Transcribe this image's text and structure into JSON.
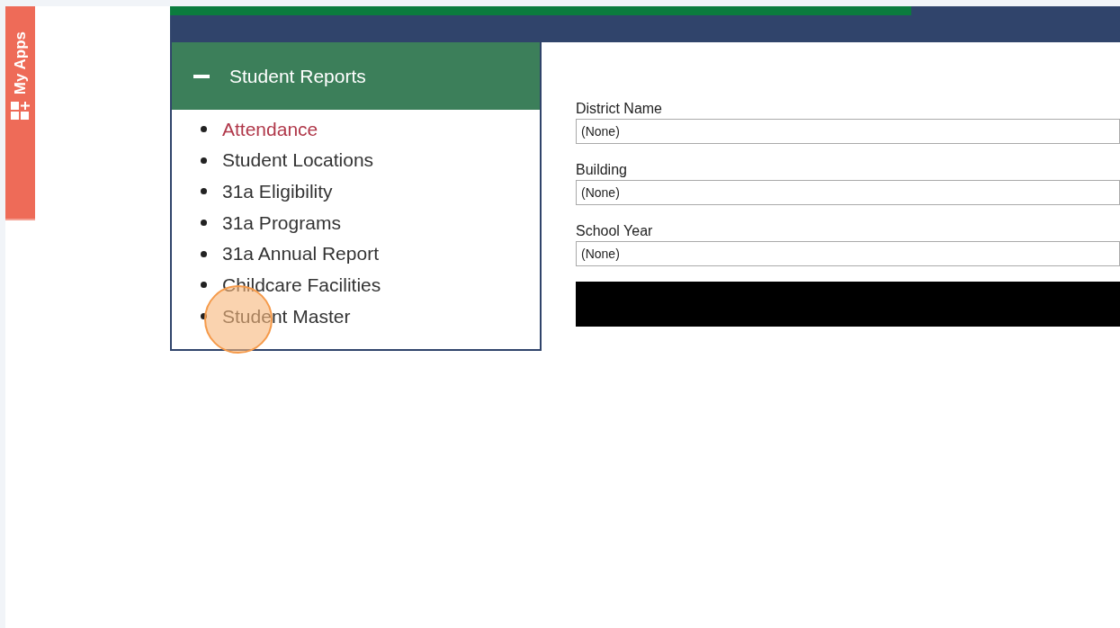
{
  "side_tab": {
    "label": "My Apps"
  },
  "top_bar": {
    "progress": {
      "level": 0.78
    }
  },
  "reports_panel": {
    "title": "Student Reports",
    "expanded": true,
    "items": [
      {
        "label": "Attendance",
        "selected": true
      },
      {
        "label": "Student Locations",
        "selected": false
      },
      {
        "label": "31a Eligibility",
        "selected": false
      },
      {
        "label": "31a Programs",
        "selected": false
      },
      {
        "label": "31a Annual Report",
        "selected": false
      },
      {
        "label": "Childcare Facilities",
        "selected": false
      },
      {
        "label": "Student Master",
        "selected": false
      }
    ]
  },
  "filters": [
    {
      "label": "District Name",
      "value": "(None)"
    },
    {
      "label": "Building",
      "value": "(None)"
    },
    {
      "label": "School Year",
      "value": "(None)"
    }
  ]
}
